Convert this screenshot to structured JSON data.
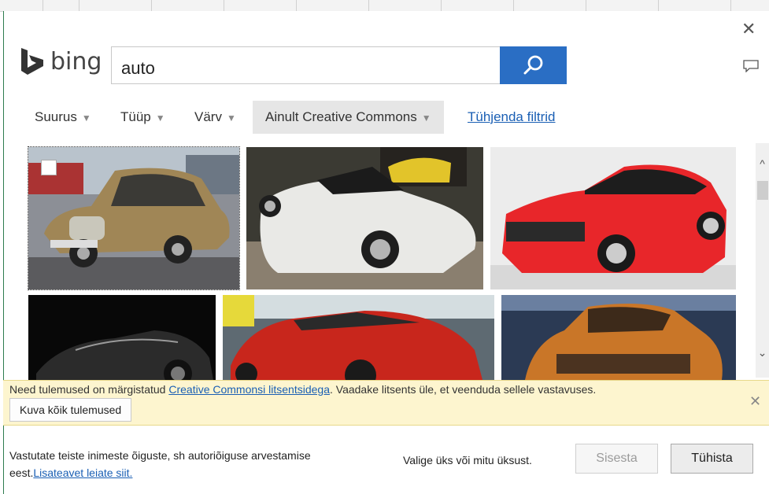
{
  "dialog": {
    "close_icon": "close-icon",
    "feedback_icon": "comment-icon"
  },
  "brand": {
    "name": "bing",
    "logo_color": "#333333"
  },
  "search": {
    "query": "auto",
    "button_icon": "search-icon",
    "button_color": "#2a6ec4"
  },
  "filters": {
    "size": "Suurus",
    "type": "Tüüp",
    "color": "Värv",
    "license": "Ainult Creative Commons",
    "clear": "Tühjenda filtrid"
  },
  "images": [
    {
      "name": "brown-vintage-car",
      "selected": true
    },
    {
      "name": "white-lamborghini-convertible",
      "selected": false
    },
    {
      "name": "red-kia-coupe",
      "selected": false
    },
    {
      "name": "black-concept-car",
      "selected": false
    },
    {
      "name": "red-concept-car",
      "selected": false
    },
    {
      "name": "orange-suv-concept",
      "selected": false
    }
  ],
  "notice": {
    "text_before": "Need tulemused on märgistatud ",
    "link": "Creative Commonsi litsentsidega",
    "text_after": ". Vaadake litsents üle, et veenduda sellele vastavuses.",
    "show_all": "Kuva kõik tulemused",
    "background": "#fdf5cf"
  },
  "footer": {
    "rights_text": "Vastutate teiste inimeste õiguste, sh autoriõiguse arvestamise eest.",
    "learn_more": "Lisateavet leiate siit.",
    "status": "Valige üks või mitu üksust.",
    "insert": "Sisesta",
    "cancel": "Tühista"
  }
}
